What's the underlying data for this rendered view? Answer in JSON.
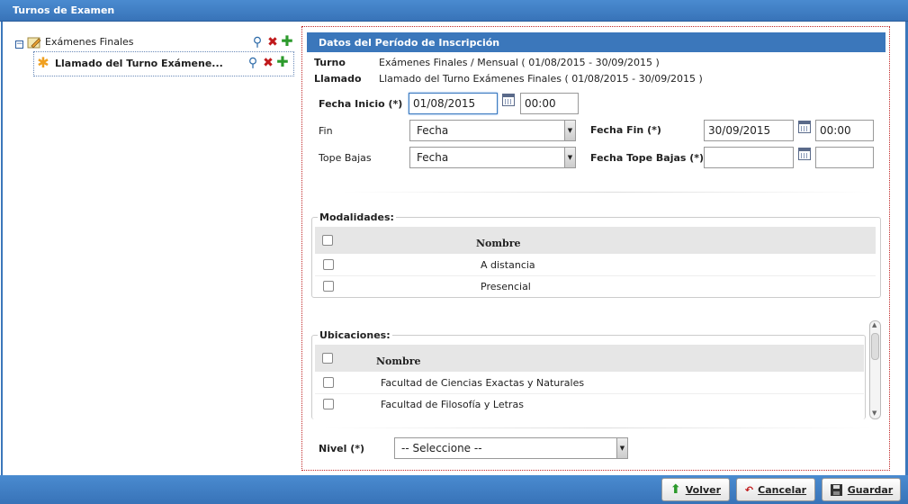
{
  "window": {
    "title": "Turnos de Examen"
  },
  "tree": {
    "root": {
      "label": "Exámenes Finales",
      "toggle": "−"
    },
    "child": {
      "label": "Llamado del Turno Exámene..."
    }
  },
  "panel": {
    "title": "Datos del Período de Inscripción",
    "turno_label": "Turno",
    "turno_value": "Exámenes Finales / Mensual ( 01/08/2015 - 30/09/2015 )",
    "llamado_label": "Llamado",
    "llamado_value": "Llamado del Turno Exámenes Finales ( 01/08/2015 - 30/09/2015 )",
    "fecha_inicio_label": "Fecha Inicio (*)",
    "fecha_inicio_value": "01/08/2015",
    "hora_inicio_value": "00:00",
    "fin_label": "Fin",
    "fin_select": "Fecha",
    "fecha_fin_label": "Fecha Fin (*)",
    "fecha_fin_value": "30/09/2015",
    "hora_fin_value": "00:00",
    "tope_bajas_label": "Tope Bajas",
    "tope_bajas_select": "Fecha",
    "fecha_tope_label": "Fecha Tope Bajas (*)",
    "fecha_tope_value": "",
    "hora_tope_value": "",
    "modalidades": {
      "legend": "Modalidades:",
      "header": "Nombre",
      "rows": [
        "A distancia",
        "Presencial"
      ]
    },
    "ubicaciones": {
      "legend": "Ubicaciones:",
      "header": "Nombre",
      "rows": [
        "Facultad de Ciencias Exactas y Naturales",
        "Facultad de Filosofía y Letras"
      ]
    },
    "nivel_label": "Nivel (*)",
    "nivel_select": "-- Seleccione --"
  },
  "footer": {
    "volver": "Volver",
    "cancelar": "Cancelar",
    "guardar": "Guardar"
  },
  "colors": {
    "header_blue": "#3b77bb",
    "panel_border": "#c02828"
  }
}
